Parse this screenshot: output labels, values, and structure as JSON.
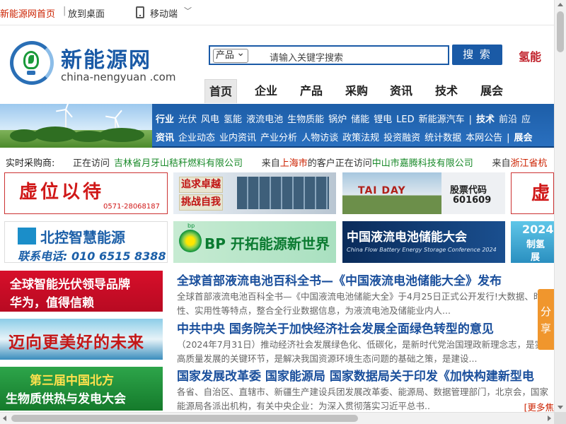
{
  "topbar": {
    "home_link": "新能源网首页",
    "separator": "|",
    "desktop_link": "放到桌面",
    "mobile_label": "移动端",
    "mobile_chevron": "﹀"
  },
  "logo": {
    "cn": "新能源网",
    "en": "china-nengyuan .com"
  },
  "search": {
    "category": "产品",
    "placeholder": "请输入关键字搜索",
    "button": "搜 索"
  },
  "header_link": "氢能",
  "main_nav": [
    "首页",
    "企业",
    "产品",
    "采购",
    "资讯",
    "技术",
    "展会"
  ],
  "banner": {
    "row1_head": "行业",
    "row1_items": [
      "光伏",
      "风电",
      "氢能",
      "液流电池",
      "生物质能",
      "锅炉",
      "储能",
      "锂电",
      "LED",
      "新能源汽车",
      "|",
      "技术",
      "前沿",
      "应"
    ],
    "row2_head": "资讯",
    "row2_items": [
      "企业动态",
      "业内资讯",
      "产业分析",
      "人物访谈",
      "政策法规",
      "投资融资",
      "统计数据",
      "本网公告",
      "|",
      "展会"
    ]
  },
  "ticker": {
    "label": "实时采购商:",
    "m1_a": "正在访问",
    "m1_b": "吉林省月牙山秸秆燃料有限公司",
    "m2_a": "来自",
    "m2_b": "上海市",
    "m2_c": "的客户正在访问",
    "m2_d": "中山市嘉腾科技有限公司",
    "m3_a": "来自",
    "m3_b": "浙江省杭"
  },
  "ads": {
    "a1_text": "虚位以待",
    "a1_tel": "0571-28068187",
    "a2_line1": "追求卓越",
    "a2_line2": "挑战自我",
    "a3_sign": "TAI DAY",
    "a3_line1": "股票代码",
    "a3_line2": "601609",
    "a4_text": "虚",
    "a5_line1": "北控智慧能源",
    "a5_line2": "联系电话: 010 6515 8388",
    "a6_logo": "bp",
    "a6_text": "BP 开拓能源新世界",
    "a7_line1": "中国液流电池储能大会",
    "a7_line2": "China Flow Battery Energy Storage Conference 2024",
    "a8_line1": "2024",
    "a8_line2": "制氢",
    "a8_line3": "展",
    "a9_line1": "全球智能光伏领导品牌",
    "a9_line2": "华为，值得信赖",
    "a10_text": "迈向更美好的未来",
    "a11_line1": "第三届中国北方",
    "a11_line2": "生物质供热与发电大会"
  },
  "news": [
    {
      "title": "全球首部液流电池百科全书—《中国液流电池储能大全》发布",
      "summary": "全球首部液流电池百科全书—《中国液流电池储能大全》于4月25日正式公开发行!大数据、时效性、实用性等特点，整合全行业数据信息，为液流电池及储能业内人..."
    },
    {
      "title": "中共中央 国务院关于加快经济社会发展全面绿色转型的意见",
      "summary": "（2024年7月31日）推动经济社会发展绿色化、低碳化，是新时代党治国理政新理念志，是实现高质量发展的关键环节，是解决我国资源环境生态问题的基础之策，是建设..."
    },
    {
      "title": "国家发展改革委 国家能源局 国家数据局关于印发《加快构建新型电",
      "summary": "各省、自治区、直辖市、新疆生产建设兵团发展改革委、能源局、数据管理部门，北京会，国家能源局各派出机构，有关中央企业：为深入贯彻落实习近平总书.."
    }
  ],
  "more_link": "[更多焦",
  "share_tab": "分享",
  "colors": {
    "brand_blue": "#1a5aa6",
    "nav_banner": "#2a70bf",
    "accent_red": "#cc2200",
    "news_title": "#1a4f9c",
    "share_orange": "#f0962d"
  }
}
